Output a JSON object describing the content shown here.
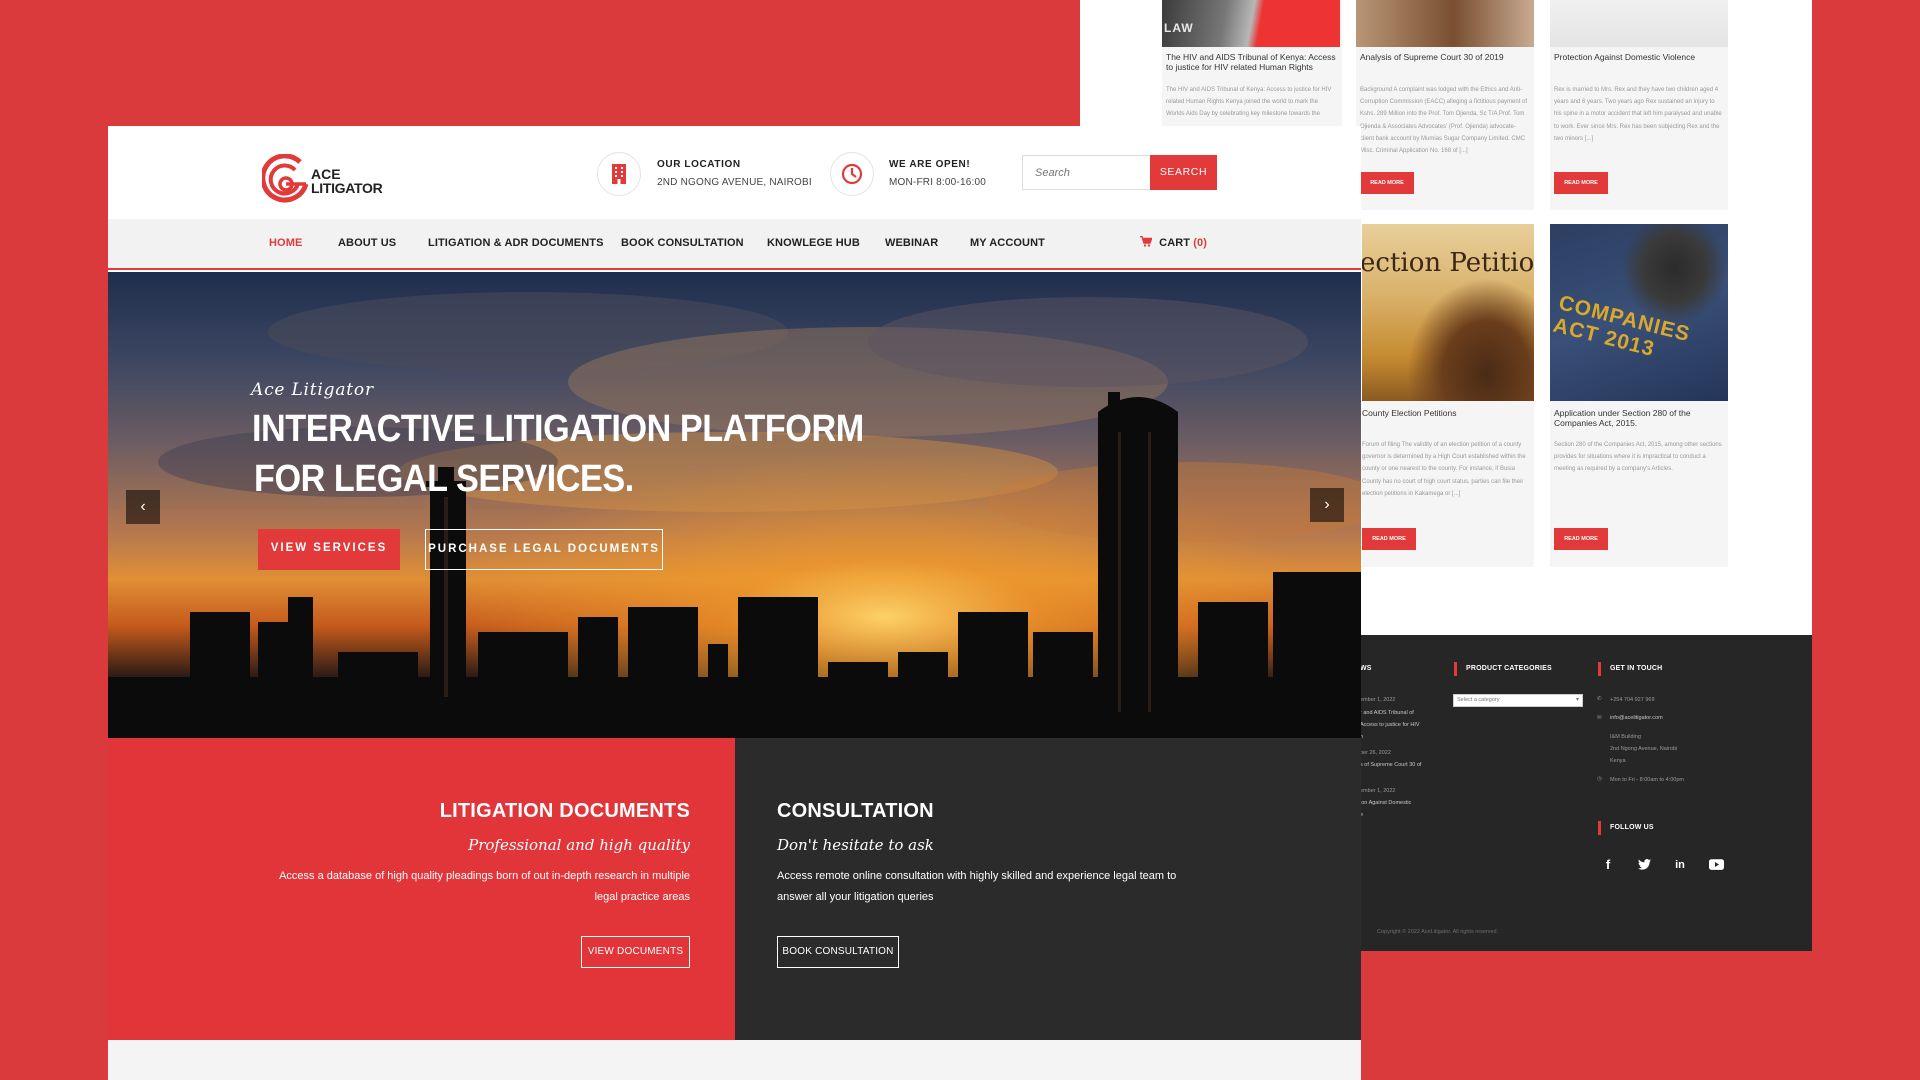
{
  "colors": {
    "accent": "#e23a3a",
    "background": "#da3a3b",
    "dark": "#2b2b2b"
  },
  "blog": {
    "cards": [
      {
        "title": "The HIV and AIDS Tribunal of Kenya: Access to justice for HIV related Human Rights",
        "excerpt": "The HIV and AIDS Tribunal of Kenya: Access to justice for HIV related Human Rights Kenya joined the world to mark the Worlds Aids Day by celebrating key milestone towards the",
        "thumb_text": "LAW",
        "read_more": ""
      },
      {
        "title": "Analysis of Supreme Court 30 of 2019",
        "excerpt": "Background A complaint was lodged with the Ethics and Anti-Corruption Commission (EACC) alleging a fictitious payment of Kshs. 289 Million into the Prof. Tom Ojienda, Sc T/A Prof. Tom Ojienda & Associates Advocates' (Prof. Ojienda) advocate-client bank account by Mumias Sugar Company Limited. CMC Misc. Criminal Application No. 168 of [...]",
        "thumb_text": "",
        "read_more": "READ MORE"
      },
      {
        "title": "Protection Against Domestic Violence",
        "excerpt": "Rex is married to Mrs. Rex and they have two children aged 4 years and 6 years. Two years ago Rex sustained an injury to his spine in a motor accident that left him paralysed and unable to work. Ever since Mrs. Rex has been subjecting Rex and the two minors [...]",
        "thumb_text": "",
        "read_more": "READ MORE"
      },
      {
        "title": "County Election Petitions",
        "excerpt": "Forum of filing The validity of an election petition of a county governor is determined by a High Court established within the county or one nearest to the county. For instance, if Busia County has no court of high court status, parties can file their election petitions in Kakamega or [...]",
        "thumb_text": "ection Petition",
        "read_more": "READ MORE"
      },
      {
        "title": "Application under Section 280 of the Companies Act, 2015.",
        "excerpt": "Section 280 of the Companies Act, 2015, among other sections provides for situations where it is impractical to conduct a meeting as required by a company's Articles.",
        "thumb_text": "COMPANIES ACT 2013",
        "read_more": "READ MORE"
      }
    ]
  },
  "footer": {
    "news_heading": "WS",
    "news_items": [
      "ember 1, 2022",
      "r and AIDS Tribunal of",
      "Access to justice for HIV",
      "h",
      "ber 26, 2022",
      "s of Supreme Court 30 of",
      "ember 1, 2022",
      "ion Against Domestic",
      "e"
    ],
    "product_categories": "PRODUCT CATEGORIES",
    "category_select": "Select a category",
    "get_in_touch": "GET IN TOUCH",
    "phone": "+254 704 927 969",
    "email": "info@acelitigator.com",
    "address": [
      "I&M Building",
      "2nd Ngong Avenue, Nairobi",
      "Kenya"
    ],
    "hours": "Mon to Fri - 8:00am to 4:00pm",
    "follow_us": "FOLLOW US",
    "social": [
      "facebook-icon",
      "twitter-icon",
      "linkedin-icon",
      "youtube-icon"
    ],
    "copyright": "Copyright © 2022 AceLitigator. All rights reserved."
  },
  "header": {
    "logo_line1": "ACE",
    "logo_line2": "LITIGATOR",
    "location_title": "OUR LOCATION",
    "location_value": "2ND NGONG AVENUE, NAIROBI",
    "hours_title": "WE ARE OPEN!",
    "hours_value": "MON-FRI 8:00-16:00",
    "search_placeholder": "Search",
    "search_button": "SEARCH"
  },
  "nav": {
    "items": [
      "HOME",
      "ABOUT US",
      "LITIGATION & ADR DOCUMENTS",
      "BOOK CONSULTATION",
      "KNOWLEGE HUB",
      "WEBINAR",
      "MY ACCOUNT"
    ],
    "cart": "CART",
    "cart_count": "(0)"
  },
  "hero": {
    "kicker": "Ace Litigator",
    "title_line1": "INTERACTIVE LITIGATION PLATFORM",
    "title_line2": "FOR LEGAL SERVICES.",
    "btn_services": "VIEW SERVICES",
    "btn_documents": "PURCHASE LEGAL DOCUMENTS"
  },
  "panels": {
    "left": {
      "title": "LITIGATION DOCUMENTS",
      "subtitle": "Professional and high quality",
      "text_line1": "Access a database of high quality pleadings born of out in-depth research in multiple",
      "text_line2": "legal practice areas",
      "button": "VIEW DOCUMENTS"
    },
    "right": {
      "title": "CONSULTATION",
      "subtitle": "Don't hesitate to ask",
      "text_line1": "Access remote online consultation with highly skilled and experience legal team to",
      "text_line2": "answer all your litigation queries",
      "button": "BOOK CONSULTATION"
    }
  }
}
